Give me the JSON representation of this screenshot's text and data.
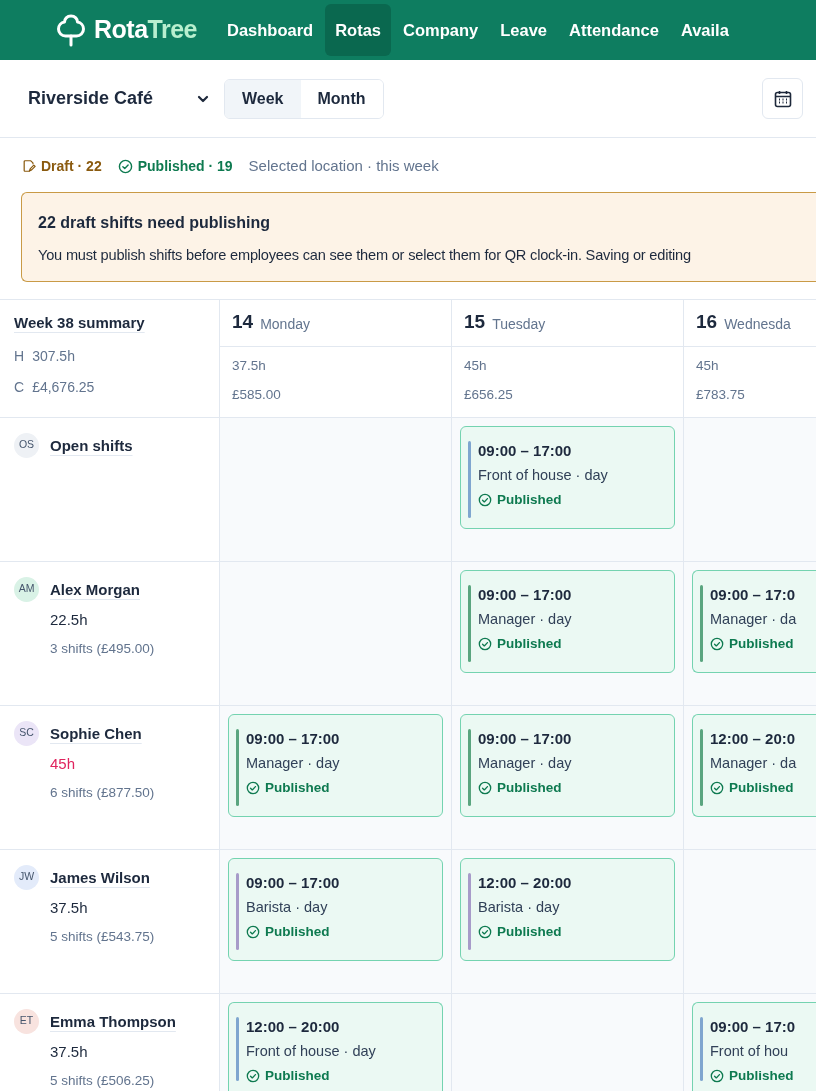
{
  "nav": {
    "brand_first": "Rota",
    "brand_second": "Tree",
    "items": [
      {
        "label": "Dashboard",
        "selected": false
      },
      {
        "label": "Rotas",
        "selected": true
      },
      {
        "label": "Company",
        "selected": false
      },
      {
        "label": "Leave",
        "selected": false
      },
      {
        "label": "Attendance",
        "selected": false
      },
      {
        "label": "Availa",
        "selected": false
      }
    ]
  },
  "toolbar": {
    "location": "Riverside Café",
    "views": [
      {
        "label": "Week",
        "selected": true
      },
      {
        "label": "Month",
        "selected": false
      }
    ]
  },
  "status_counts": [
    {
      "kind": "draft",
      "label": "Draft · 22"
    },
    {
      "kind": "published",
      "label": "Published · 19"
    }
  ],
  "scope": "Selected location · this week",
  "banner": {
    "title": "22 draft shifts need publishing",
    "message": "You must publish shifts before employees can see them or select them for QR clock-in. Saving or editing"
  },
  "summary": {
    "title": "Week 38 summary",
    "hours_label": "H",
    "hours": "307.5h",
    "cost_label": "C",
    "cost": "£4,676.25"
  },
  "days": [
    {
      "date": "14",
      "day": "Monday",
      "hours": "37.5h",
      "cost": "£585.00"
    },
    {
      "date": "15",
      "day": "Tuesday",
      "hours": "45h",
      "cost": "£656.25"
    },
    {
      "date": "16",
      "day": "Wednesda",
      "hours": "45h",
      "cost": "£783.75"
    }
  ],
  "rows": [
    {
      "initials": "OS",
      "name": "Open shifts",
      "color": "#eef1f5",
      "cells": [
        null,
        {
          "time": "09:00 – 17:00",
          "role": "Front of house · day",
          "color": "#7fa6cf",
          "status": {
            "kind": "published",
            "label": "Published"
          }
        },
        null
      ]
    },
    {
      "initials": "AM",
      "name": "Alex Morgan",
      "color": "#d9f2e6",
      "hours": "22.5h",
      "hours_over": false,
      "shifts_summary": "3 shifts (£495.00)",
      "cells": [
        null,
        {
          "time": "09:00 – 17:00",
          "role": "Manager · day",
          "color": "#5aa57f",
          "status": {
            "kind": "published",
            "label": "Published"
          }
        },
        {
          "time": "09:00 – 17:0",
          "role": "Manager · da",
          "color": "#5aa57f",
          "status": {
            "kind": "published",
            "label": "Published"
          }
        }
      ]
    },
    {
      "initials": "SC",
      "name": "Sophie Chen",
      "color": "#ebe5f7",
      "hours": "45h",
      "hours_over": true,
      "shifts_summary": "6 shifts (£877.50)",
      "cells": [
        {
          "time": "09:00 – 17:00",
          "role": "Manager · day",
          "color": "#5aa57f",
          "status": {
            "kind": "published",
            "label": "Published"
          }
        },
        {
          "time": "09:00 – 17:00",
          "role": "Manager · day",
          "color": "#5aa57f",
          "status": {
            "kind": "published",
            "label": "Published"
          }
        },
        {
          "time": "12:00 – 20:0",
          "role": "Manager · da",
          "color": "#5aa57f",
          "status": {
            "kind": "published",
            "label": "Published"
          }
        }
      ]
    },
    {
      "initials": "JW",
      "name": "James Wilson",
      "color": "#e3ebfa",
      "hours": "37.5h",
      "hours_over": false,
      "shifts_summary": "5 shifts (£543.75)",
      "cells": [
        {
          "time": "09:00 – 17:00",
          "role": "Barista · day",
          "color": "#a79bc9",
          "status": {
            "kind": "published",
            "label": "Published"
          }
        },
        {
          "time": "12:00 – 20:00",
          "role": "Barista · day",
          "color": "#a79bc9",
          "status": {
            "kind": "published",
            "label": "Published"
          }
        },
        null
      ]
    },
    {
      "initials": "ET",
      "name": "Emma Thompson",
      "color": "#f8e3df",
      "hours": "37.5h",
      "hours_over": false,
      "shifts_summary": "5 shifts (£506.25)",
      "cells": [
        {
          "time": "12:00 – 20:00",
          "role": "Front of house · day",
          "color": "#7fa6cf",
          "status": {
            "kind": "published",
            "label": "Published"
          }
        },
        null,
        {
          "time": "09:00 – 17:0",
          "role": "Front of hou",
          "color": "#7fa6cf",
          "status": {
            "kind": "published",
            "label": "Published"
          }
        }
      ]
    }
  ]
}
